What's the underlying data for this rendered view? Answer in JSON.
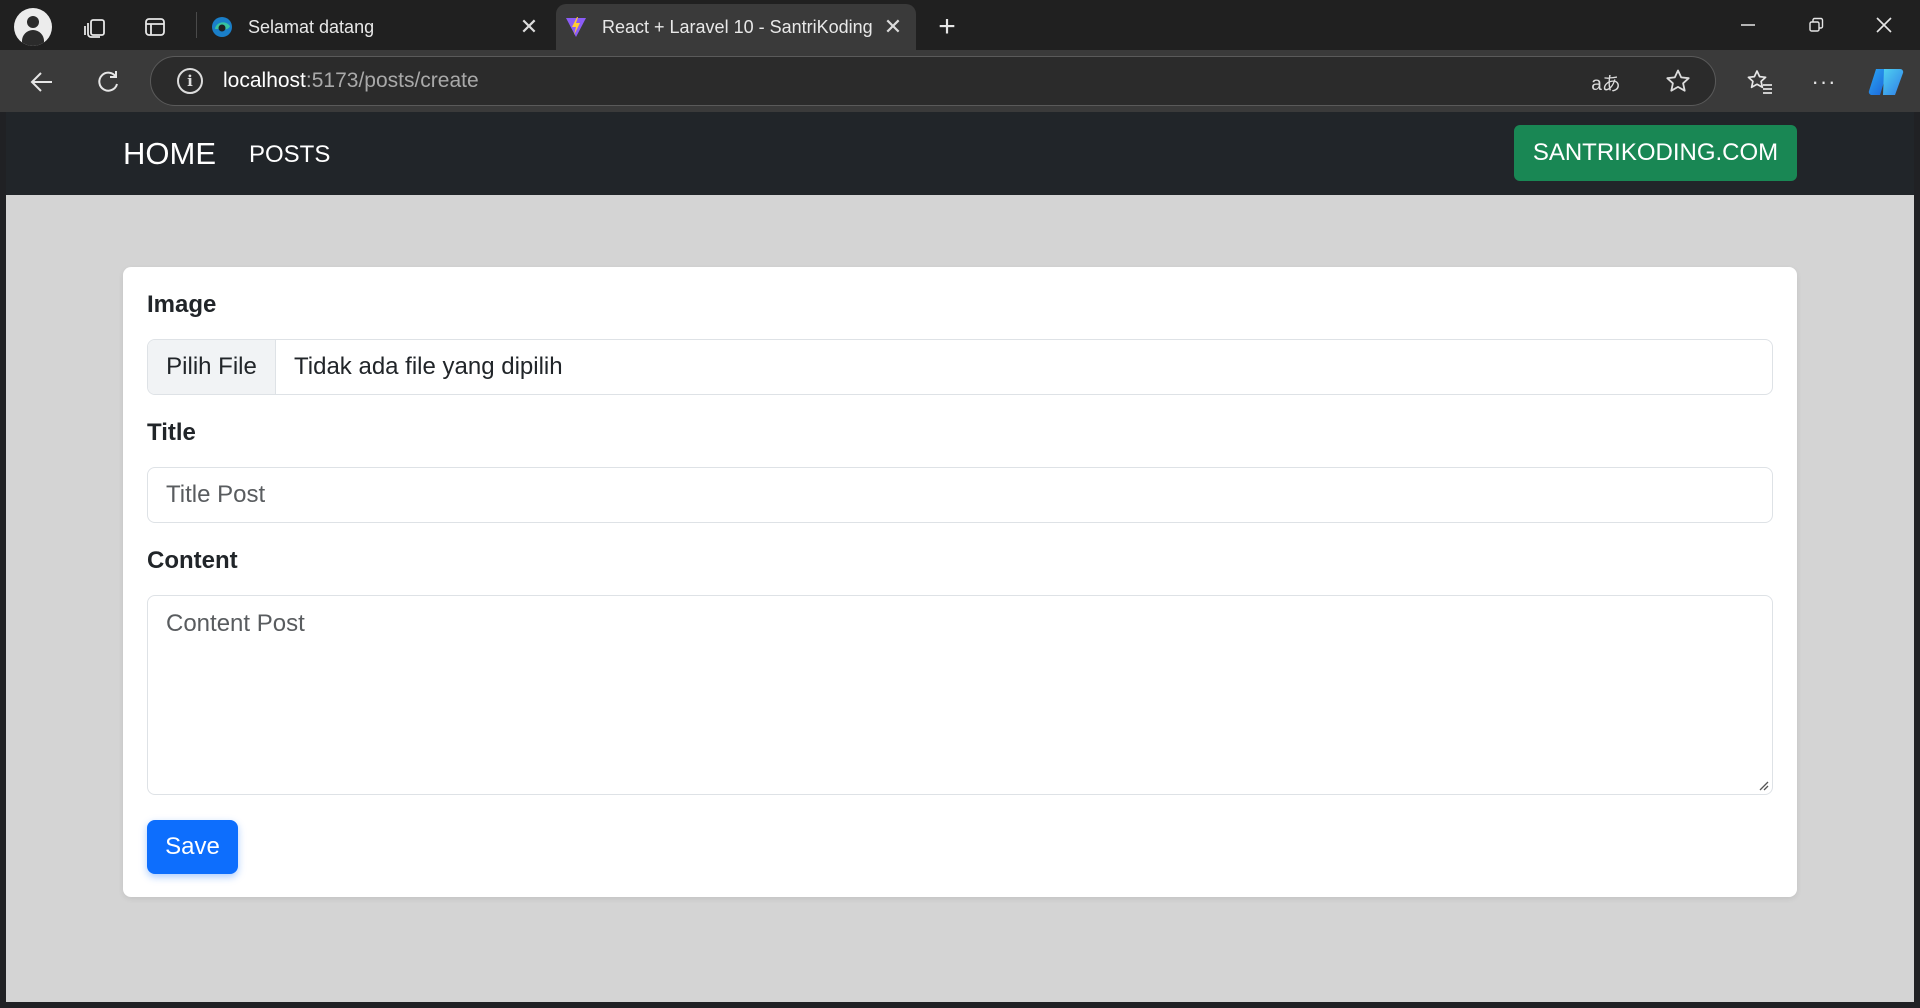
{
  "browser": {
    "tabs": [
      {
        "title": "Selamat datang",
        "active": false
      },
      {
        "title": "React + Laravel 10 - SantriKoding",
        "active": true
      }
    ],
    "address": {
      "host": "localhost",
      "rest": ":5173/posts/create"
    },
    "icons": [
      "profile-icon",
      "collections-icon",
      "tab-actions-icon",
      "edge-icon",
      "vite-icon",
      "close-icon",
      "new-tab-icon",
      "minimize-icon",
      "restore-icon",
      "window-close-icon",
      "back-icon",
      "refresh-icon",
      "site-info-icon",
      "read-aloud-icon",
      "favorite-star-icon",
      "favorites-icon",
      "more-icon",
      "copilot-icon"
    ]
  },
  "navbar": {
    "home": "HOME",
    "posts": "POSTS",
    "brand": "SANTRIKODING.COM"
  },
  "form": {
    "image_label": "Image",
    "file_button": "Pilih File",
    "file_status": "Tidak ada file yang dipilih",
    "title_label": "Title",
    "title_placeholder": "Title Post",
    "content_label": "Content",
    "content_placeholder": "Content Post",
    "save": "Save"
  },
  "colors": {
    "navbar_bg": "#212529",
    "brand_button": "#198754",
    "save_button": "#0d6efd",
    "page_bg": "#d4d4d4"
  }
}
